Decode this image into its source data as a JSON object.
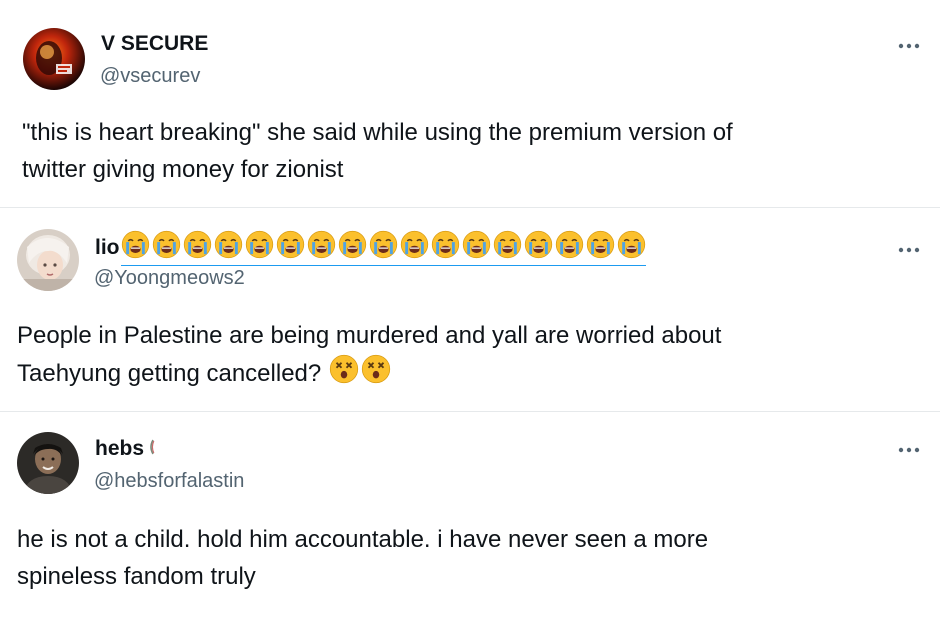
{
  "posts": [
    {
      "display_name": "V SECURE",
      "handle": "@vsecurev",
      "text_lines": [
        "\"this is heart breaking\" she said while using the premium version of",
        "twitter giving money for zionist"
      ],
      "avatar_label": "V SECURE",
      "emojis": []
    },
    {
      "display_name": "lio",
      "handle": "@Yoongmeows2",
      "name_emoji": "loudly-crying-face",
      "name_emoji_count": 17,
      "text_lines": [
        "People in Palestine are being murdered and yall are worried about",
        "Taehyung getting cancelled?"
      ],
      "trailing_emoji": "dizzy-face",
      "trailing_emoji_count": 2
    },
    {
      "display_name": "hebs",
      "name_suffix_icon": "watermelon-slice-icon",
      "handle": "@hebsforfalastin",
      "text_lines": [
        "he is not a child. hold him accountable. i have never seen a more",
        "spineless fandom truly"
      ]
    }
  ],
  "more_icon": "more-horizontal-icon",
  "colors": {
    "text": "#0f1419",
    "secondary": "#536471",
    "divider": "#e6e9eb",
    "link_underline": "#1d9bf0",
    "emoji_yellow": "#fbc02d"
  }
}
